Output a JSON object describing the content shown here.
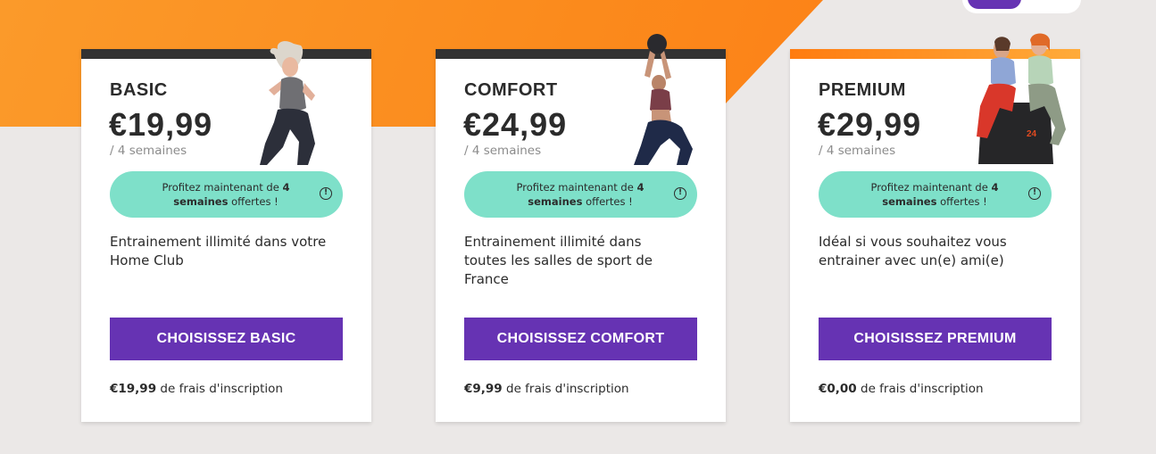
{
  "plans": [
    {
      "name": "BASIC",
      "price": "€19,99",
      "period": "/ 4 semaines",
      "promo_pre": "Profitez maintenant de ",
      "promo_bold": "4 semaines",
      "promo_post": " offertes !",
      "info_glyph": "!",
      "description": "Entrainement illimité dans votre Home Club",
      "cta": "CHOISISSEZ BASIC",
      "fee_amount": "€19,99",
      "fee_text": " de frais d'inscription",
      "photo": "woman-boxing-photo"
    },
    {
      "name": "COMFORT",
      "price": "€24,99",
      "period": "/ 4 semaines",
      "promo_pre": "Profitez maintenant de ",
      "promo_bold": "4 semaines",
      "promo_post": " offertes !",
      "info_glyph": "!",
      "description": "Entrainement illimité dans toutes les salles de sport de France",
      "cta": "CHOISISSEZ COMFORT",
      "fee_amount": "€9,99",
      "fee_text": " de frais d'inscription",
      "photo": "woman-medicine-ball-photo"
    },
    {
      "name": "PREMIUM",
      "price": "€29,99",
      "period": "/ 4 semaines",
      "promo_pre": "Profitez maintenant de ",
      "promo_bold": "4 semaines",
      "promo_post": " offertes !",
      "info_glyph": "!",
      "description": "Idéal si vous souhaitez vous entrainer avec un(e) ami(e)",
      "cta": "CHOISISSEZ PREMIUM",
      "fee_amount": "€0,00",
      "fee_text": " de frais d'inscription",
      "photo": "two-women-friends-photo"
    }
  ],
  "colors": {
    "accent": "#6633b3",
    "promo": "#7ee0c9",
    "orange": "#fb8a1c",
    "background": "#ebe8e7"
  }
}
